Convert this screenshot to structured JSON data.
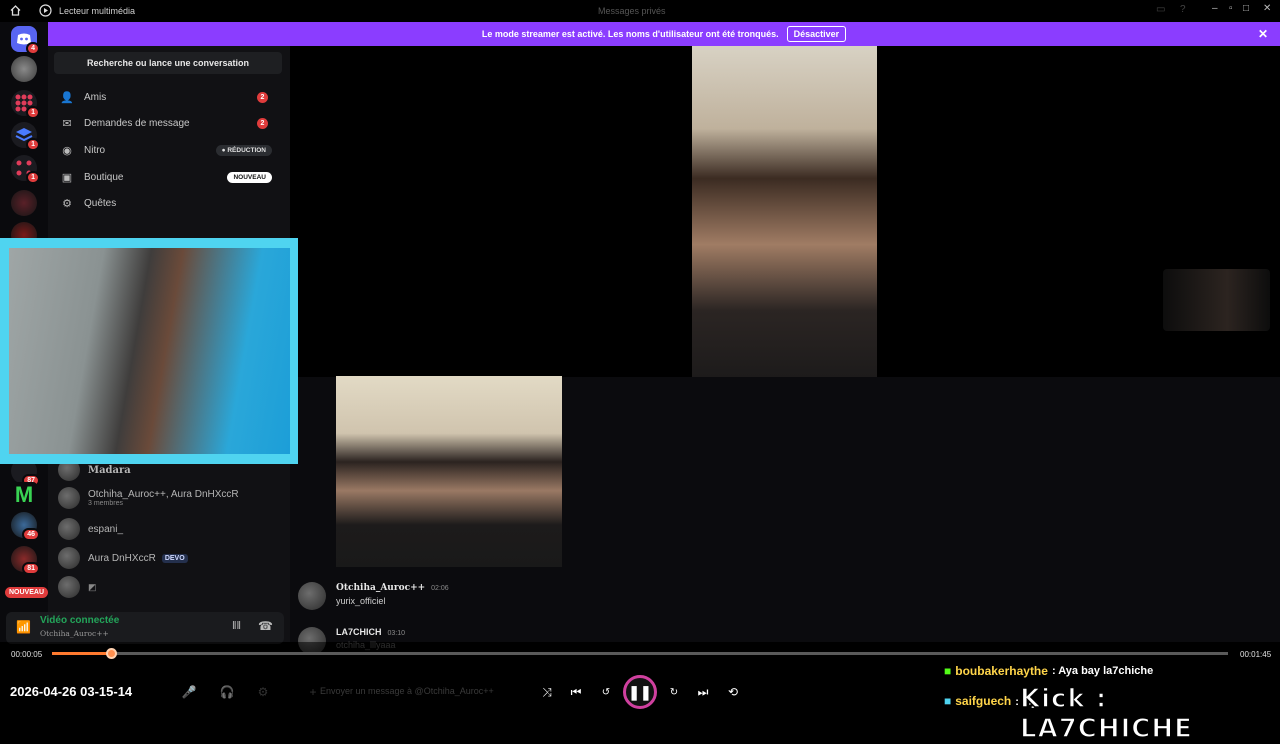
{
  "titlebar": {
    "app_title": "Lecteur multimédia",
    "center_title": "Messages privés"
  },
  "banner": {
    "text": "Le mode streamer est activé. Les noms d'utilisateur ont été tronqués.",
    "button": "Désactiver"
  },
  "servers": {
    "badges": [
      "4",
      "1",
      "1",
      "1",
      "87",
      "46",
      "81"
    ],
    "new_label": "NOUVEAU"
  },
  "dm": {
    "search_label": "Recherche ou lance une conversation",
    "nav": [
      {
        "label": "Amis",
        "count": "2",
        "icon": "friends-icon"
      },
      {
        "label": "Demandes de message",
        "count": "2",
        "icon": "mail-icon"
      },
      {
        "label": "Nitro",
        "pill": "RÉDUCTION",
        "icon": "nitro-icon"
      },
      {
        "label": "Boutique",
        "pill": "NOUVEAU",
        "icon": "shop-icon"
      },
      {
        "label": "Quêtes",
        "icon": "quests-icon"
      }
    ],
    "list": [
      {
        "name": "Madara"
      },
      {
        "name": "Otchiha_Auroc++, Aura DnHXccR",
        "sub": "3 membres"
      },
      {
        "name": "espani_"
      },
      {
        "name": "Aura DnHXccR",
        "tag": "DEVO"
      }
    ]
  },
  "voice": {
    "status": "Vidéo connectée",
    "channel": "Otchiha_Auroc++"
  },
  "messages": [
    {
      "user": "Otchiha_Auroc++",
      "time": "02:06",
      "text": "yurix_officiel"
    },
    {
      "user": "LA7CHICH",
      "time": "03:10",
      "text": "otchiha_lllyaaa"
    }
  ],
  "composer": {
    "placeholder": "Envoyer un message à @Otchiha_Auroc++"
  },
  "player": {
    "elapsed": "00:00:05",
    "total": "00:01:45",
    "progress": 0.05
  },
  "overlay": {
    "timestamp": "2026-04-26 03-15-14",
    "chat": [
      {
        "user": "boubakerhaythe",
        "text": ": Aya bay la7chiche",
        "color": "#ffd54a"
      },
      {
        "user": "saifguech",
        "text": ": رب",
        "color": "#ffd54a"
      }
    ],
    "kick_label": "Kick : LA7CHICHE"
  }
}
